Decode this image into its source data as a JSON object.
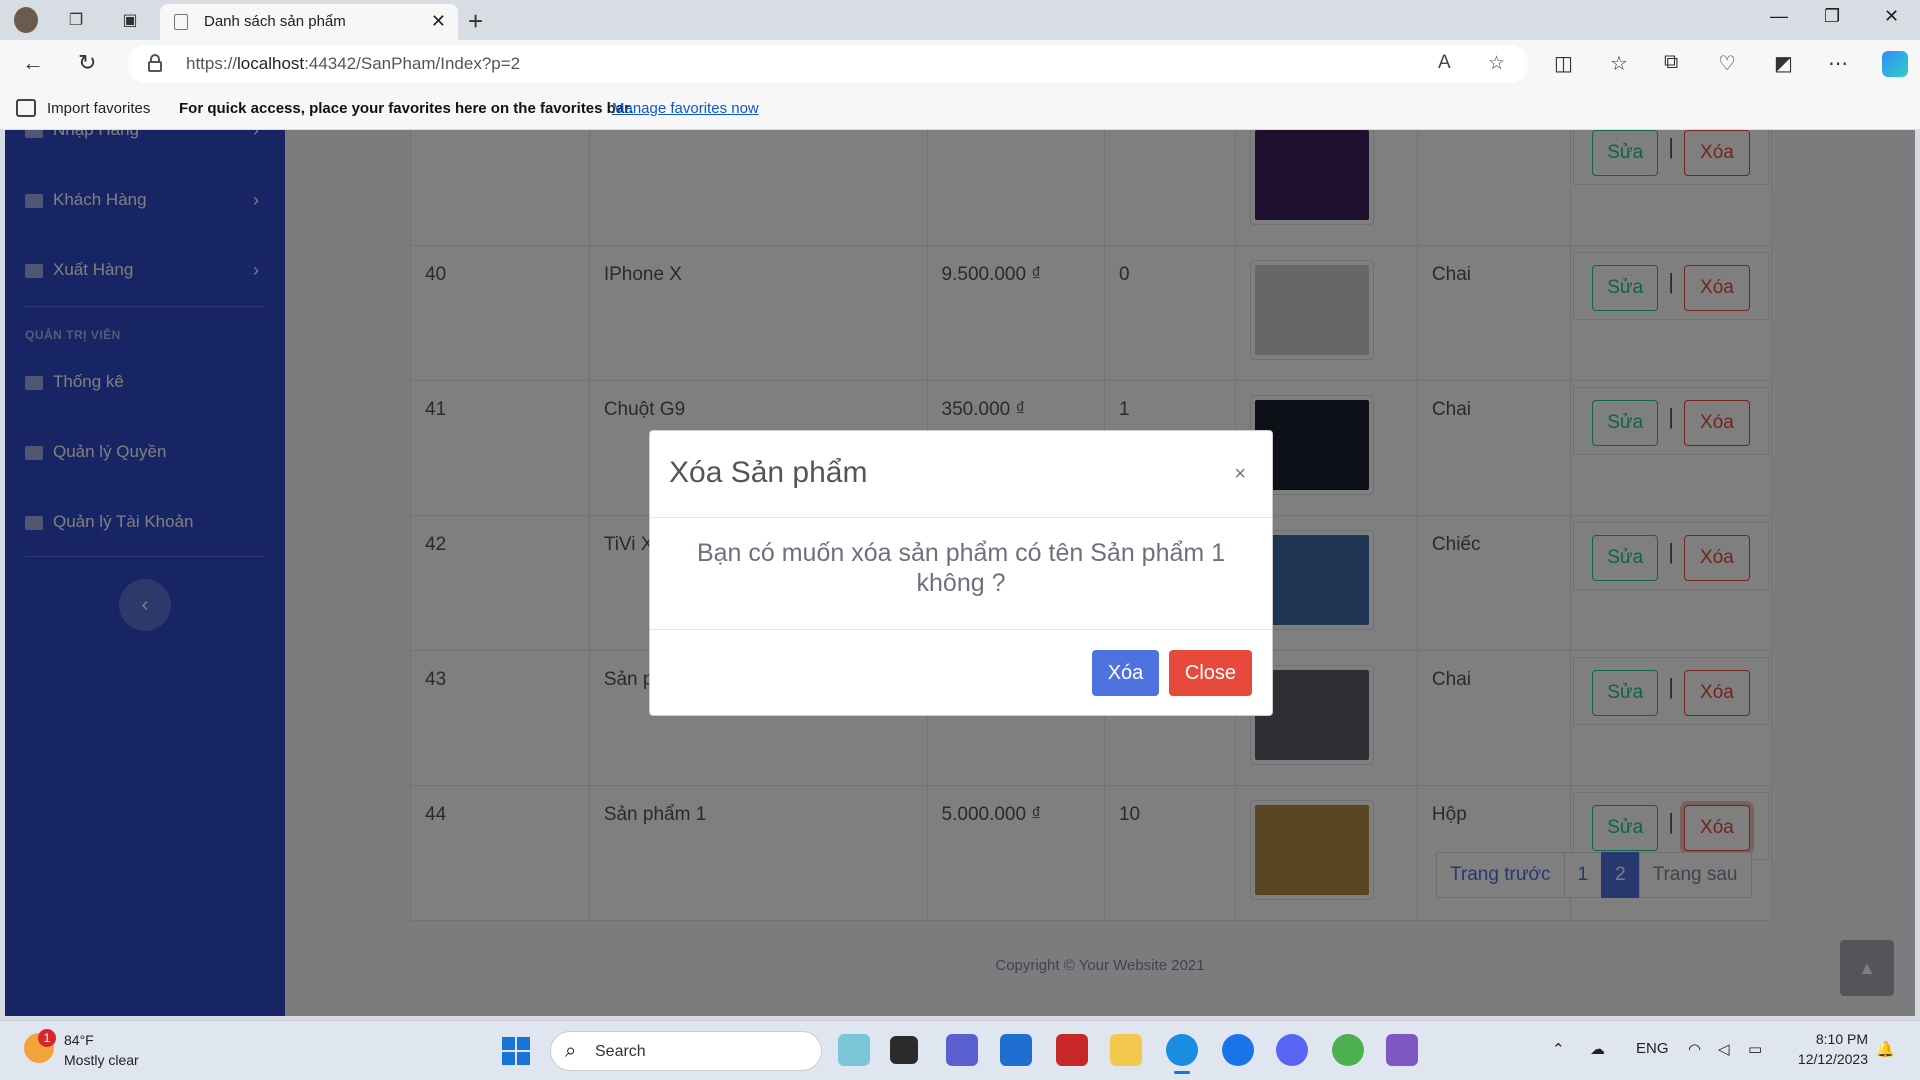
{
  "browser": {
    "tab_title": "Danh sách sản phẩm",
    "url_prefix": "https://",
    "url_host": "localhost",
    "url_rest": ":44342/SanPham/Index?p=2"
  },
  "favorites_bar": {
    "import_label": "Import favorites",
    "message": "For quick access, place your favorites here on the favorites bar.",
    "manage_link": "Manage favorites now"
  },
  "sidebar": {
    "items_top": [
      {
        "label": "Nhập Hàng"
      },
      {
        "label": "Khách Hàng"
      },
      {
        "label": "Xuất Hàng"
      }
    ],
    "admin_heading": "QUẢN TRỊ VIÊN",
    "admin_items": [
      {
        "label": "Thống kê"
      },
      {
        "label": "Quản lý Quyền"
      },
      {
        "label": "Quản lý Tài Khoản"
      }
    ],
    "toggle_icon": "‹"
  },
  "table": {
    "rows": [
      {
        "id": "",
        "name": "",
        "price": "",
        "qty": "",
        "unit": "",
        "edit": "Sửa",
        "delete": "Xóa",
        "img_color": "#3a1f5a"
      },
      {
        "id": "40",
        "name": "IPhone X",
        "price": "9.500.000 ₫",
        "qty": "0",
        "unit": "Chai",
        "edit": "Sửa",
        "delete": "Xóa",
        "img_color": "#cfcfcf"
      },
      {
        "id": "41",
        "name": "Chuột G9",
        "price": "350.000 ₫",
        "qty": "1",
        "unit": "Chai",
        "edit": "Sửa",
        "delete": "Xóa",
        "img_color": "#1c2030"
      },
      {
        "id": "42",
        "name": "TiVi X",
        "price": "",
        "qty": "",
        "unit": "Chiếc",
        "edit": "Sửa",
        "delete": "Xóa",
        "img_color": "#3f6aa8"
      },
      {
        "id": "43",
        "name": "Sản p",
        "price": "",
        "qty": "",
        "unit": "Chai",
        "edit": "Sửa",
        "delete": "Xóa",
        "img_color": "#5a5f6b"
      },
      {
        "id": "44",
        "name": "Sản phẩm 1",
        "price": "5.000.000 ₫",
        "qty": "10",
        "unit": "Hộp",
        "edit": "Sửa",
        "delete": "Xóa",
        "img_color": "#b58a45"
      }
    ]
  },
  "pagination": {
    "prev": "Trang trước",
    "pages": [
      "1",
      "2"
    ],
    "active_page": "2",
    "next": "Trang sau"
  },
  "footer": {
    "copyright": "Copyright © Your Website 2021"
  },
  "modal": {
    "title": "Xóa Sản phẩm",
    "close_x": "×",
    "message": "Bạn có muốn xóa sản phẩm có tên Sản phẩm 1 không ?",
    "confirm_label": "Xóa",
    "close_label": "Close"
  },
  "taskbar": {
    "weather_badge": "1",
    "temperature": "84°F",
    "weather_desc": "Mostly clear",
    "search_label": "Search",
    "language": "ENG",
    "time": "8:10 PM",
    "date": "12/12/2023"
  },
  "colors": {
    "sidebar": "#2e4bc9",
    "primary": "#4e73df",
    "success": "#1cc88a",
    "danger": "#e74a3b"
  }
}
